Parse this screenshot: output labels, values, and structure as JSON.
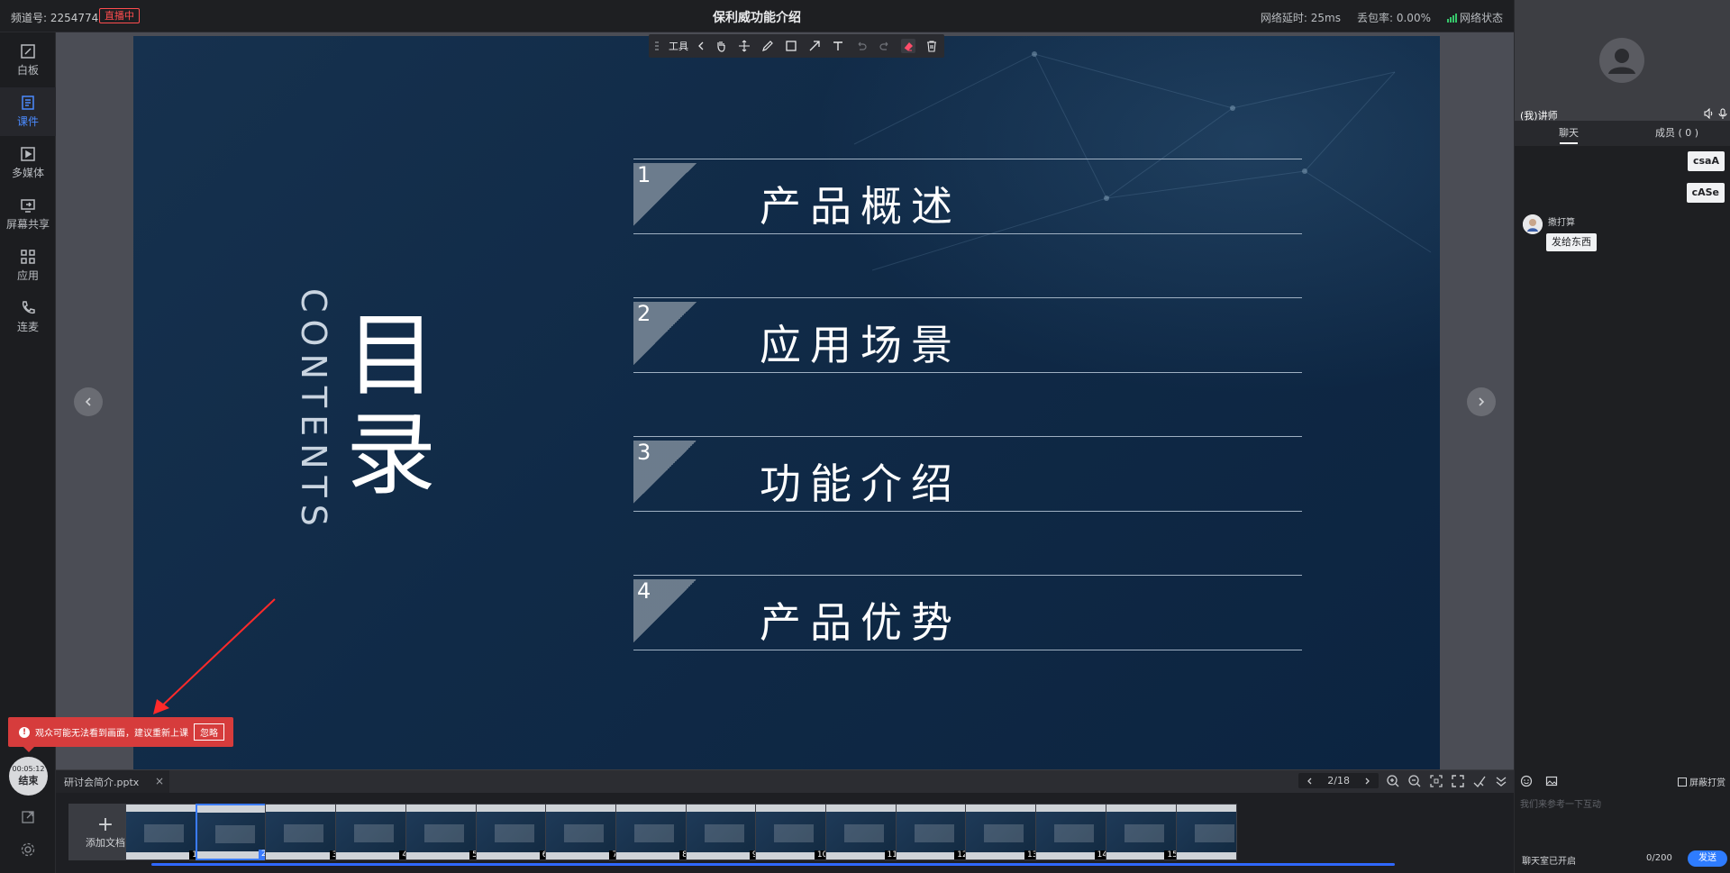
{
  "header": {
    "channel_label": "频道号: 2254774",
    "live_badge": "直播中",
    "title": "保利威功能介绍",
    "latency": "网络延时: 25ms",
    "packet_loss": "丢包率: 0.00%",
    "network_status": "网络状态"
  },
  "sidebar": {
    "items": [
      {
        "label": "白板",
        "icon": "whiteboard-icon"
      },
      {
        "label": "课件",
        "icon": "courseware-icon"
      },
      {
        "label": "多媒体",
        "icon": "media-icon"
      },
      {
        "label": "屏幕共享",
        "icon": "screen-share-icon"
      },
      {
        "label": "应用",
        "icon": "apps-icon"
      },
      {
        "label": "连麦",
        "icon": "phone-icon"
      }
    ],
    "timer": "00:05:12",
    "end_label": "结束"
  },
  "toolbar": {
    "label": "工具"
  },
  "slide": {
    "contents_en": "CONTENTS",
    "contents_cn": "目录",
    "items": [
      {
        "num": "1",
        "text": "产品概述"
      },
      {
        "num": "2",
        "text": "应用场景"
      },
      {
        "num": "3",
        "text": "功能介绍"
      },
      {
        "num": "4",
        "text": "产品优势"
      }
    ]
  },
  "warning": {
    "text": "观众可能无法看到画面，建议重新上课",
    "ignore_label": "忽略"
  },
  "docbar": {
    "tab_name": "研讨会简介.pptx",
    "close": "×",
    "page": "2/18"
  },
  "thumbs": {
    "add_label": "添加文档",
    "pages": [
      "1",
      "2",
      "3",
      "4",
      "5",
      "6",
      "7",
      "8",
      "9",
      "10",
      "11",
      "12",
      "13",
      "14",
      "15"
    ]
  },
  "right": {
    "video_tag": "(我)讲师",
    "tab_chat": "聊天",
    "tab_members": "成员 ( 0 )",
    "msgs_self": [
      "csaA",
      "cASe"
    ],
    "msg_user": "撒打算",
    "msg_text": "发给东西",
    "shield_label": "屏蔽打赏",
    "input_placeholder": "我们来参考一下互动",
    "chat_on": "聊天室已开启",
    "count": "0/200",
    "send_label": "发送"
  }
}
